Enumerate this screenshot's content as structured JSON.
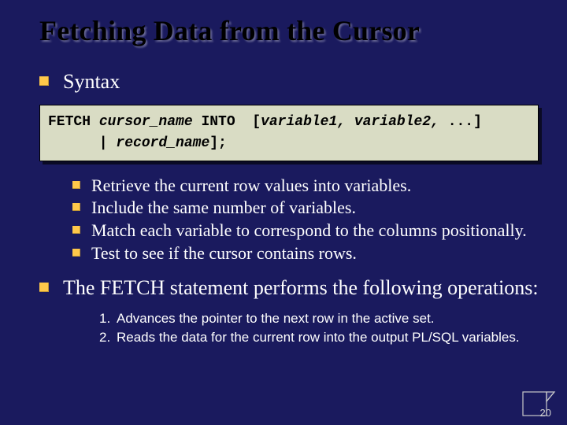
{
  "title": "Fetching Data from the Cursor",
  "syntax_label": "Syntax",
  "code_line1_kw1": "FETCH ",
  "code_line1_it1": "cursor_name",
  "code_line1_kw2": " INTO  [",
  "code_line1_it2": "variable1, variable2,",
  "code_line1_kw3": " ...]",
  "code_line2_kw1": "      | ",
  "code_line2_it1": "record_name",
  "code_line2_kw2": "];",
  "sub": {
    "b1": "Retrieve the current row values into variables.",
    "b2": "Include the same number of variables.",
    "b3": "Match each variable to correspond to the columns positionally.",
    "b4": "Test to see if the cursor contains rows."
  },
  "fetch_intro": "The FETCH statement performs the following operations:",
  "ops": {
    "n1": "1.",
    "t1": "Advances the pointer to the next row in the active set.",
    "n2": "2.",
    "t2": "Reads the data for the current row into the output PL/SQL variables."
  },
  "page_number": "20"
}
